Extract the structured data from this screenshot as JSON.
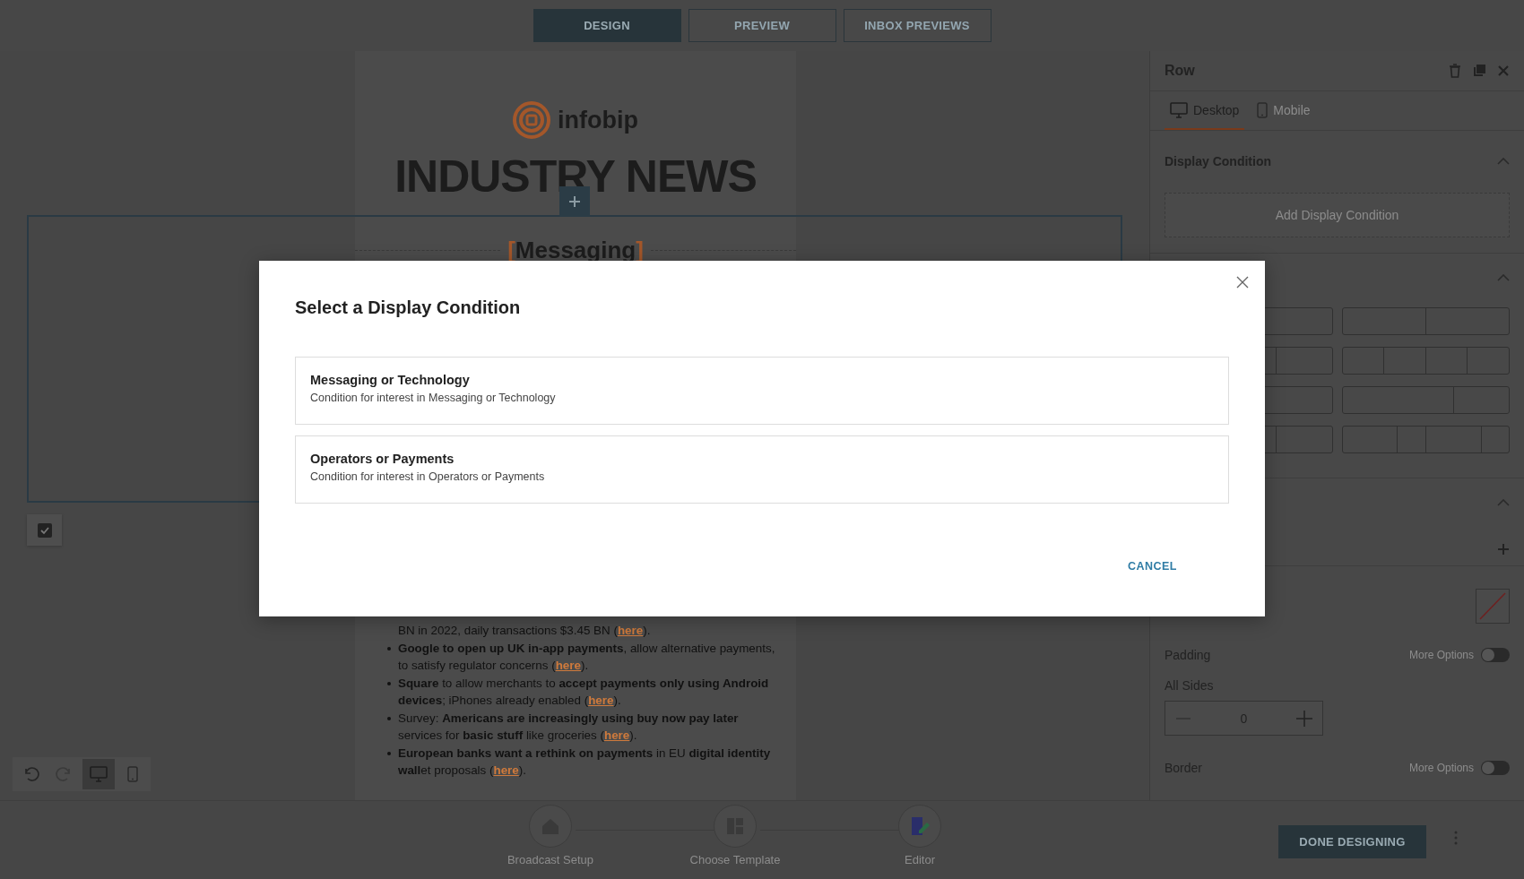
{
  "top_tabs": [
    {
      "label": "DESIGN",
      "selected": true
    },
    {
      "label": "PREVIEW",
      "selected": false
    },
    {
      "label": "INBOX PREVIEWS",
      "selected": false
    }
  ],
  "email": {
    "logo_text": "infobip",
    "title": "INDUSTRY NEWS",
    "section_heading": {
      "open": "[",
      "text": "Messaging",
      "close": "]"
    },
    "items": [
      {
        "kind": "continuation",
        "parts": [
          {
            "kind": "text",
            "text": "BN in 2022, daily transactions $3.45 BN ("
          },
          {
            "kind": "link",
            "text": "here"
          },
          {
            "kind": "text",
            "text": ")."
          }
        ]
      },
      {
        "kind": "bullet",
        "parts": [
          {
            "kind": "text",
            "text": "**Google to open up UK in-app payments**, allow alternative payments, to satisfy regulator concerns ("
          },
          {
            "kind": "link",
            "text": "here"
          },
          {
            "kind": "text",
            "text": ")."
          }
        ]
      },
      {
        "kind": "bullet",
        "parts": [
          {
            "kind": "text",
            "text": "**Square** to allow merchants to **accept payments only using Android devices**; iPhones already enabled ("
          },
          {
            "kind": "link",
            "text": "here"
          },
          {
            "kind": "text",
            "text": ")."
          }
        ]
      },
      {
        "kind": "bullet",
        "parts": [
          {
            "kind": "text",
            "text": "Survey: **Americans are increasingly using buy now pay later** services for **basic stuff** like groceries ("
          },
          {
            "kind": "link",
            "text": "here"
          },
          {
            "kind": "text",
            "text": ")."
          }
        ]
      },
      {
        "kind": "bullet",
        "parts": [
          {
            "kind": "text",
            "text": "**European banks want a rethink on payments** in EU **digital identity wall**et proposals ("
          },
          {
            "kind": "link",
            "text": "here"
          },
          {
            "kind": "text",
            "text": ")."
          }
        ]
      }
    ]
  },
  "row_checkbox": {
    "checked": true
  },
  "view_modes": [
    {
      "kind": "desktop",
      "selected": true
    },
    {
      "kind": "mobile",
      "selected": false
    }
  ],
  "side_panel": {
    "title": "Row",
    "device_tabs": [
      {
        "label": "Desktop",
        "kind": "desktop",
        "selected": true
      },
      {
        "label": "Mobile",
        "kind": "mobile",
        "selected": false
      }
    ],
    "display_condition": {
      "title": "Display Condition",
      "add_button": "Add Display Condition"
    },
    "padding": {
      "label": "Padding",
      "more_options_label": "More Options",
      "more_options_on": false,
      "sides_label": "All Sides",
      "value": "0"
    },
    "border": {
      "label": "Border",
      "more_options_label": "More Options",
      "more_options_on": false
    }
  },
  "steps": [
    {
      "label": "Broadcast Setup",
      "kind": "setup",
      "current": false
    },
    {
      "label": "Choose Template",
      "kind": "template",
      "current": false
    },
    {
      "label": "Editor",
      "kind": "editor",
      "current": true
    }
  ],
  "done_button": "DONE DESIGNING",
  "modal": {
    "title": "Select a Display Condition",
    "options": [
      {
        "title": "Messaging or Technology",
        "description": "Condition for interest in Messaging or Technology"
      },
      {
        "title": "Operators or Payments",
        "description": "Condition for interest in Operators or Payments"
      }
    ],
    "cancel": "CANCEL"
  }
}
